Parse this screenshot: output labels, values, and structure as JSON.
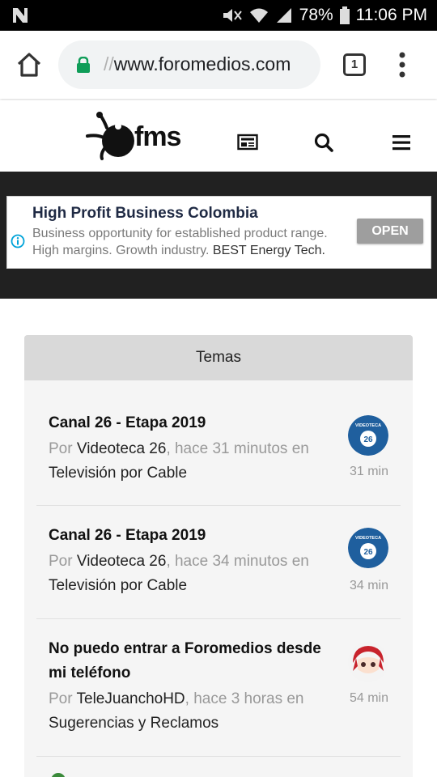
{
  "status_bar": {
    "battery": "78%",
    "time": "11:06 PM"
  },
  "browser": {
    "url_prefix": "//",
    "url": "www.foromedios.com",
    "tab_count": "1"
  },
  "site": {
    "logo_text": "fms"
  },
  "ad": {
    "title": "High Profit Business Colombia",
    "description": "Business opportunity for established product range. High margins. Growth industry.",
    "brand": "BEST Energy Tech.",
    "button": "OPEN"
  },
  "panel": {
    "heading": "Temas",
    "topics": [
      {
        "title": "Canal 26 - Etapa 2019",
        "by": "Por",
        "author": "Videoteca 26",
        "ago_text": ", hace 31 minutos en",
        "forum": "Televisión por Cable",
        "time": "31 min",
        "avatar_text": "VIDEOTECA"
      },
      {
        "title": "Canal 26 - Etapa 2019",
        "by": "Por",
        "author": "Videoteca 26",
        "ago_text": ", hace 34 minutos en",
        "forum": "Televisión por Cable",
        "time": "34 min",
        "avatar_text": "VIDEOTECA"
      },
      {
        "title": "No puedo entrar a Foromedios desde mi teléfono",
        "by": "Por",
        "author": "TeleJuanchoHD",
        "ago_text": ", hace 3 horas en",
        "forum": "Sugerencias y Reclamos",
        "time": "54 min"
      }
    ]
  },
  "colors": {
    "status_bar": "#000000",
    "ad_band": "#212121",
    "panel_bg": "#f5f5f5",
    "panel_head": "#d9d9d9",
    "avatar_blue": "#1f5f9e",
    "lock_green": "#0f9d58"
  }
}
